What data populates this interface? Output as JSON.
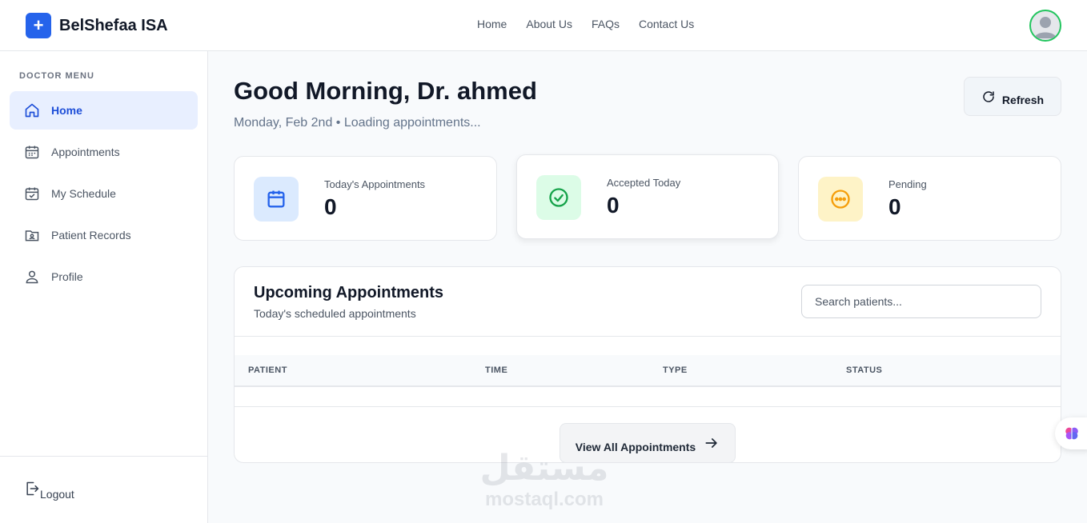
{
  "brand": {
    "logo_glyph": "+",
    "name": "BelShefaa ISA",
    "color": "#2563eb"
  },
  "topnav": {
    "items": [
      "Home",
      "About Us",
      "FAQs",
      "Contact Us"
    ]
  },
  "user": {
    "avatar_icon": "user-avatar-icon",
    "ring_color": "#22c55e"
  },
  "sidebar": {
    "heading": "DOCTOR MENU",
    "items": [
      {
        "label": "Home",
        "icon": "home-icon",
        "active": true
      },
      {
        "label": "Appointments",
        "icon": "calendar-icon"
      },
      {
        "label": "My Schedule",
        "icon": "calendar-check-icon"
      },
      {
        "label": "Patient Records",
        "icon": "id-folder-icon"
      },
      {
        "label": "Profile",
        "icon": "user-icon"
      }
    ],
    "logout": "Logout"
  },
  "header": {
    "greeting": "Good Morning, Dr. ahmed",
    "subtitle": "Monday, Feb 2nd • Loading appointments...",
    "refresh_label": "Refresh"
  },
  "stats": [
    {
      "label": "Today's Appointments",
      "value": "0",
      "icon": "calendar-icon",
      "color": "#2563eb",
      "bg": "#dbeafe"
    },
    {
      "label": "Accepted Today",
      "value": "0",
      "icon": "check-circle-icon",
      "color": "#16a34a",
      "bg": "#dcfce7"
    },
    {
      "label": "Pending",
      "value": "0",
      "icon": "more-circle-icon",
      "color": "#f59e0b",
      "bg": "#fef3c7"
    }
  ],
  "appointments": {
    "title": "Upcoming Appointments",
    "subtitle": "Today's scheduled appointments",
    "search_placeholder": "Search patients...",
    "columns": [
      "PATIENT",
      "TIME",
      "TYPE",
      "STATUS"
    ],
    "rows": [],
    "view_all_label": "View All Appointments"
  },
  "watermark": {
    "arabic": "مستقل",
    "latin": "mostaql.com"
  }
}
